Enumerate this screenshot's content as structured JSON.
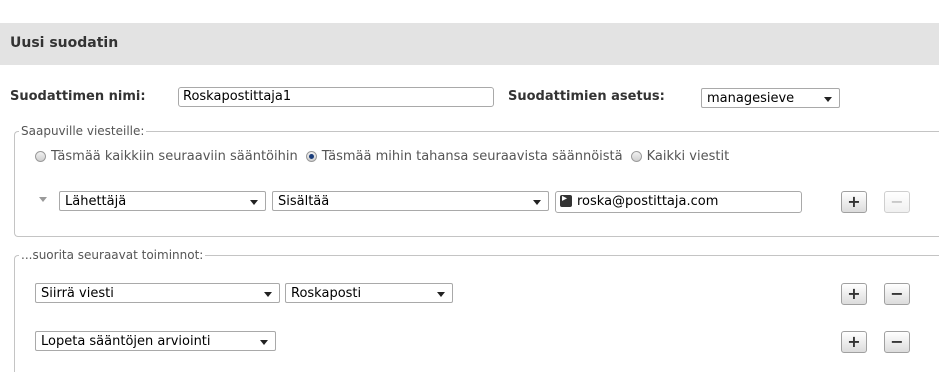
{
  "header": {
    "title": "Uusi suodatin"
  },
  "filter_name": {
    "label": "Suodattimen nimi:",
    "value": "Roskapostittaja1"
  },
  "filter_set": {
    "label": "Suodattimien asetus:",
    "value": "managesieve"
  },
  "incoming": {
    "legend": "Saapuville viesteille:",
    "options": [
      {
        "label": "Täsmää kaikkiin seuraaviin sääntöihin",
        "checked": false
      },
      {
        "label": "Täsmää mihin tahansa seuraavista säännöistä",
        "checked": true
      },
      {
        "label": "Kaikki viestit",
        "checked": false
      }
    ],
    "rule": {
      "header_select": "Lähettäjä",
      "op_select": "Sisältää",
      "value": "roska@postittaja.com",
      "add_label": "+",
      "remove_label": "−"
    }
  },
  "actions": {
    "legend": "...suorita seuraavat toiminnot:",
    "rows": [
      {
        "action": "Siirrä viesti",
        "target": "Roskaposti",
        "add_label": "+",
        "remove_label": "−"
      },
      {
        "action": "Lopeta sääntöjen arviointi",
        "add_label": "+",
        "remove_label": "−"
      }
    ]
  }
}
